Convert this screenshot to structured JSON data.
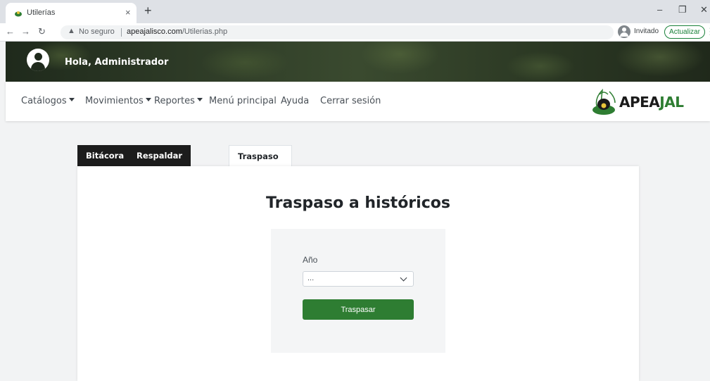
{
  "browser": {
    "tab_title": "Utilerías",
    "tab_close": "×",
    "new_tab": "+",
    "security_warning": "No seguro",
    "url_host": "apeajalisco.com",
    "url_path": "/Utilerias.php",
    "profile_label": "Invitado",
    "update_label": "Actualizar",
    "icons": [
      "back-arrow-icon",
      "forward-arrow-icon",
      "reload-icon",
      "warning-icon",
      "profile-icon",
      "menu-dots-icon",
      "minimize-icon",
      "restore-icon",
      "close-icon"
    ]
  },
  "header": {
    "greeting": "Hola, Administrador",
    "avatar_icon": "user-circle-icon"
  },
  "navbar": {
    "items": [
      {
        "label": "Catálogos",
        "dropdown": true
      },
      {
        "label": "Movimientos",
        "dropdown": true
      },
      {
        "label": "Reportes",
        "dropdown": true
      },
      {
        "label": "Menú principal",
        "dropdown": false
      },
      {
        "label": "Ayuda",
        "dropdown": false
      },
      {
        "label": "Cerrar sesión",
        "dropdown": false
      }
    ],
    "logo": {
      "part1": "APEA",
      "part2": "JAL"
    }
  },
  "tabs": [
    {
      "label": "Bitácora",
      "active": false
    },
    {
      "label": "Respaldar y restaurar",
      "active": false
    },
    {
      "label": "Traspaso a históricos",
      "active": true
    }
  ],
  "main": {
    "title": "Traspaso a históricos",
    "year_label": "Año",
    "year_value": "...",
    "submit_label": "Traspasar"
  },
  "colors": {
    "accent_green": "#2e7d32",
    "dark_tab": "#1c1c1c"
  }
}
